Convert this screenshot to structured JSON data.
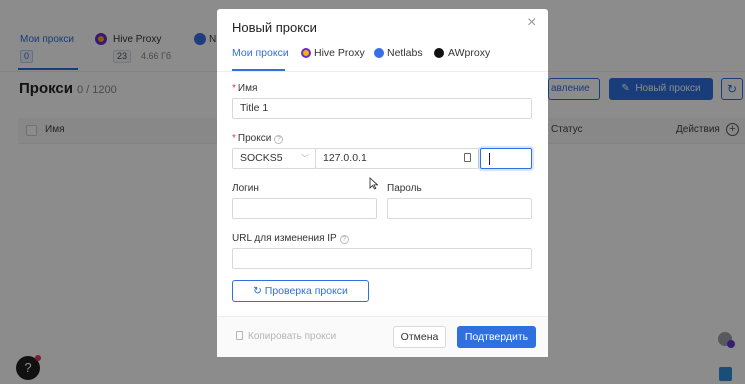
{
  "background": {
    "tabs": [
      {
        "label": "Мои прокси",
        "count": "0"
      },
      {
        "label": "Hive Proxy",
        "count": "23",
        "size": "4.66 Гб"
      },
      {
        "label": "N"
      }
    ],
    "title": "Прокси",
    "title_count": "0 / 1200",
    "btn_ghost": "авление",
    "btn_new_proxy": "Новый прокси",
    "table_headers": {
      "name": "Имя",
      "status": "Статус",
      "actions": "Действия"
    },
    "help_icon": "question-icon"
  },
  "modal": {
    "title": "Новый прокси",
    "tabs": [
      "Мои прокси",
      "Hive Proxy",
      "Netlabs",
      "AWproxy"
    ],
    "name": {
      "label": "Имя",
      "value": "Title 1"
    },
    "proxy": {
      "label": "Прокси",
      "type": "SOCKS5",
      "host": "127.0.0.1",
      "port": ""
    },
    "login": {
      "label": "Логин",
      "value": ""
    },
    "password": {
      "label": "Пароль",
      "value": ""
    },
    "change_ip_url": {
      "label": "URL для изменения IP",
      "value": ""
    },
    "check_button": "Проверка прокси",
    "copy_button": "Копировать прокси",
    "cancel_button": "Отмена",
    "confirm_button": "Подтвердить"
  },
  "colors": {
    "accent": "#2f6fde",
    "required": "#e5394b",
    "hive_dot": "#f5b000",
    "hive_ring": "#6a2ad8",
    "netlabs": "#3a6ee8"
  }
}
